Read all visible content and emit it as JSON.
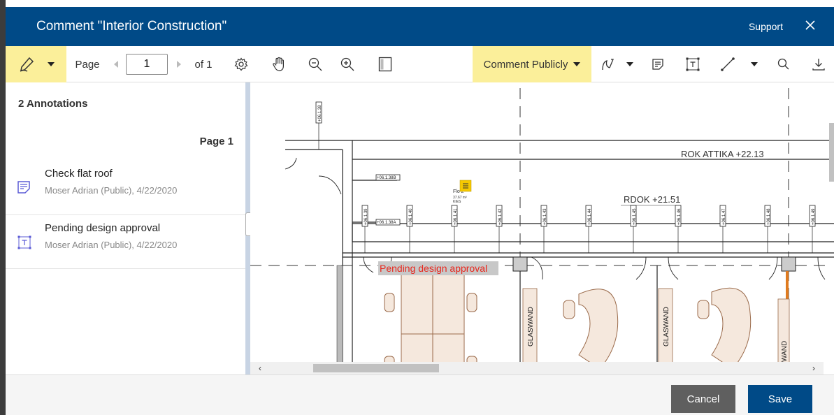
{
  "window": {
    "title": "Comment \"Interior Construction\"",
    "support_label": "Support"
  },
  "toolbar": {
    "page_label": "Page",
    "page_value": "1",
    "page_of": "of 1",
    "comment_mode": "Comment Publicly",
    "icons": [
      "pen-icon",
      "chevron-down-icon",
      "prev-page-icon",
      "next-page-icon",
      "settings-icon",
      "pan-hand-icon",
      "zoom-out-icon",
      "zoom-in-icon",
      "fit-page-icon",
      "freehand-icon",
      "note-icon",
      "text-box-icon",
      "line-icon",
      "search-icon",
      "download-icon"
    ]
  },
  "sidebar": {
    "count_label": "2 Annotations",
    "page_label": "Page 1",
    "annotations": [
      {
        "title": "Check flat roof",
        "meta": "Moser Adrian (Public), 4/22/2020",
        "icon": "note-icon"
      },
      {
        "title": "Pending design approval",
        "meta": "Moser Adrian (Public), 4/22/2020",
        "icon": "text-box-icon"
      }
    ]
  },
  "drawing": {
    "labels": {
      "rok_attika": "ROK ATTIKA +22.13",
      "rdok": "RDOK +21.51",
      "glaswand1": "GLASWAND",
      "glaswand2": "GLASWAND",
      "glaswand3": "WAND",
      "annotation_text": "Pending design approval",
      "room_label": "Flo     2",
      "room_area": "37.67 m²",
      "room_code": "KIES"
    },
    "tags": [
      "+06.1.38",
      "+06.1.38B",
      "+06.1.38A",
      "+06.1.39",
      "+06.1.40",
      "+06.1.41",
      "+06.1.42",
      "+06.1.43",
      "+06.1.44",
      "+06.1.45",
      "+06.1.46",
      "+06.1.47",
      "+06.1.48",
      "+06.1.49"
    ]
  },
  "footer": {
    "cancel_label": "Cancel",
    "save_label": "Save"
  },
  "colors": {
    "title_bar": "#004a87",
    "toolbar_highlight": "#fbef9a",
    "cancel_button": "#5f5f5f",
    "save_button": "#004a87",
    "annotation_text": "#e8261c",
    "furniture_fill": "#f5e8dd",
    "furniture_stroke": "#9a6a4a",
    "annotation_icon": "#5b5bd6"
  }
}
